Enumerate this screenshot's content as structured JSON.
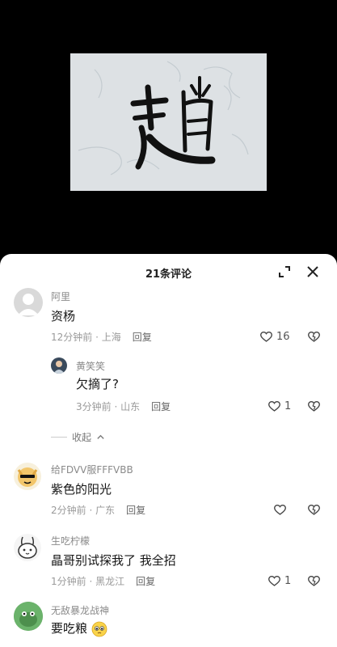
{
  "sheet": {
    "title": "21条评论"
  },
  "comments": [
    {
      "name": "阿里",
      "text": "资杨",
      "time": "12分钟前",
      "location": "上海",
      "reply_label": "回复",
      "likes": "16"
    },
    {
      "name": "黄笑笑",
      "text": "欠摘了?",
      "time": "3分钟前",
      "location": "山东",
      "reply_label": "回复",
      "likes": "1"
    },
    {
      "name": "给FDVV服FFFVBB",
      "text": "紫色的阳光",
      "time": "2分钟前",
      "location": "广东",
      "reply_label": "回复",
      "likes": ""
    },
    {
      "name": "生吃柠檬",
      "text": "晶哥别试探我了 我全招",
      "time": "1分钟前",
      "location": "黑龙江",
      "reply_label": "回复",
      "likes": "1"
    },
    {
      "name": "无敌暴龙战神",
      "text": "要吃粮",
      "time": "",
      "location": "",
      "reply_label": "",
      "likes": ""
    }
  ],
  "collapse_label": "收起",
  "separator": " · ",
  "icons": [
    "expand-icon",
    "close-icon",
    "heart-icon",
    "dislike-heart-icon",
    "chevron-up-icon"
  ],
  "colors": {
    "sheet_bg": "#ffffff",
    "video_bg": "#000000",
    "text": "#161616",
    "meta": "#9a9a9a"
  }
}
